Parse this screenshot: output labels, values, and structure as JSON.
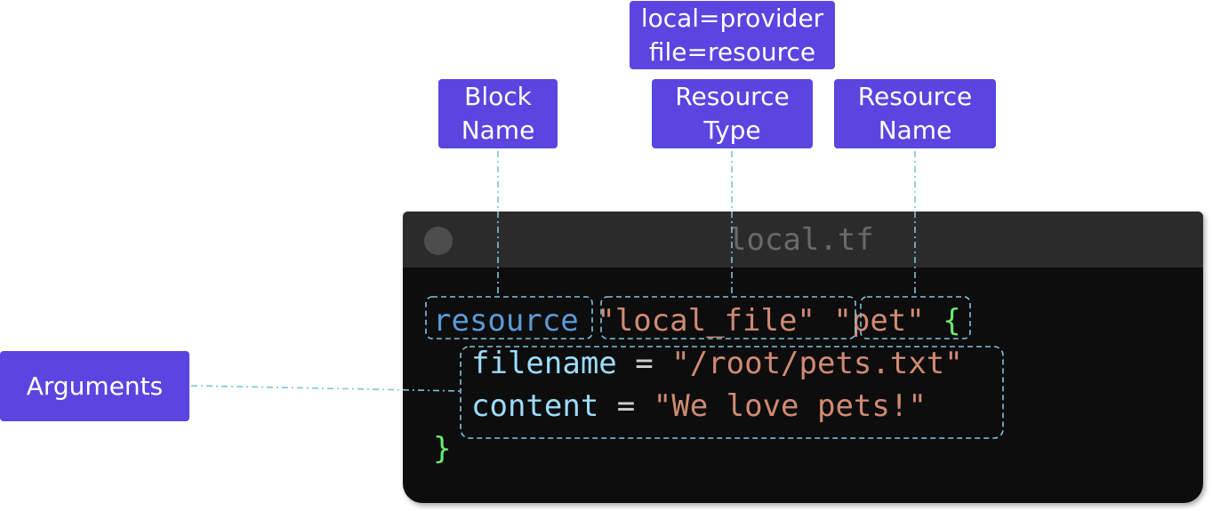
{
  "labels": {
    "provider_line1": "local=provider",
    "provider_line2": "file=resource",
    "block_name_line1": "Block",
    "block_name_line2": "Name",
    "resource_type_line1": "Resource",
    "resource_type_line2": "Type",
    "resource_name_line1": "Resource",
    "resource_name_line2": "Name",
    "arguments": "Arguments"
  },
  "editor": {
    "filename": "local.tf",
    "code": {
      "keyword": "resource",
      "resource_type": "\"local_file\"",
      "resource_name": "\"pet\"",
      "open_brace": "{",
      "arg1_name": "filename",
      "arg1_eq": "=",
      "arg1_value": "\"/root/pets.txt\"",
      "arg2_name": "content",
      "arg2_eq": "=",
      "arg2_value": "\"We love pets!\"",
      "close_brace": "}"
    }
  },
  "colors": {
    "label_bg": "#5b45e0",
    "editor_bg": "#0d0d0d",
    "titlebar_bg": "#2b2b2b",
    "keyword": "#5a9ad8",
    "string": "#d08a72",
    "identifier": "#9cdcfe",
    "brace": "#6ee86e",
    "connector": "#7ec3e0"
  }
}
